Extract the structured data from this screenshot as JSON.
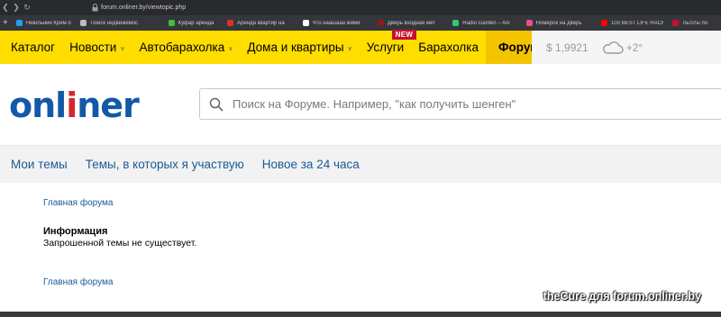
{
  "browser": {
    "url": "forum.onliner.by/viewtopic.php",
    "bookmarks": [
      {
        "label": "Невільний Крим он",
        "color": "#1da1f2"
      },
      {
        "label": "Поиск недвижимос",
        "color": "#bbbbbb"
      },
      {
        "label": "Куфар аренда",
        "color": "#3cc13b"
      },
      {
        "label": "Аренда квартир на",
        "color": "#d9342b"
      },
      {
        "label": "Что наашааа жими",
        "color": "#ffffff"
      },
      {
        "label": "Дверь входная мет",
        "color": "#8b1a1a"
      },
      {
        "label": "Radio Garden – Ani",
        "color": "#2ecc71"
      },
      {
        "label": "Номерок на дверь",
        "color": "#e94f8a"
      },
      {
        "label": "100 BEST LIFE HACK",
        "color": "#ff0000"
      },
      {
        "label": "Льготы по",
        "color": "#c8102e"
      }
    ]
  },
  "topnav": {
    "items": [
      {
        "label": "Каталог",
        "chevron": false
      },
      {
        "label": "Новости",
        "chevron": true
      },
      {
        "label": "Автобарахолка",
        "chevron": true
      },
      {
        "label": "Дома и квартиры",
        "chevron": true
      },
      {
        "label": "Услуги",
        "chevron": false,
        "badge": "NEW"
      },
      {
        "label": "Барахолка",
        "chevron": false
      },
      {
        "label": "Форум",
        "chevron": false,
        "active": true
      }
    ],
    "currency": "$ 1,9921",
    "temperature": "+2°"
  },
  "header": {
    "logo_part1": "onl",
    "logo_part2": "i",
    "logo_part3": "ner",
    "search_placeholder": "Поиск на Форуме. Например, \"как получить шенген\""
  },
  "subnav": {
    "tabs": [
      "Мои темы",
      "Темы, в которых я участвую",
      "Новое за 24 часа"
    ]
  },
  "content": {
    "breadcrumb_top": "Главная форума",
    "info_title": "Информация",
    "info_message": "Запрошенной темы не существует.",
    "breadcrumb_bottom": "Главная форума"
  },
  "watermark": "theCure для forum.onliner.by",
  "colors": {
    "nav_yellow": "#ffdd00",
    "active_tab": "#f5c400",
    "link_blue": "#1a5a96",
    "logo_blue": "#1259a8",
    "logo_red": "#d4262f",
    "badge_red": "#c8102e"
  }
}
